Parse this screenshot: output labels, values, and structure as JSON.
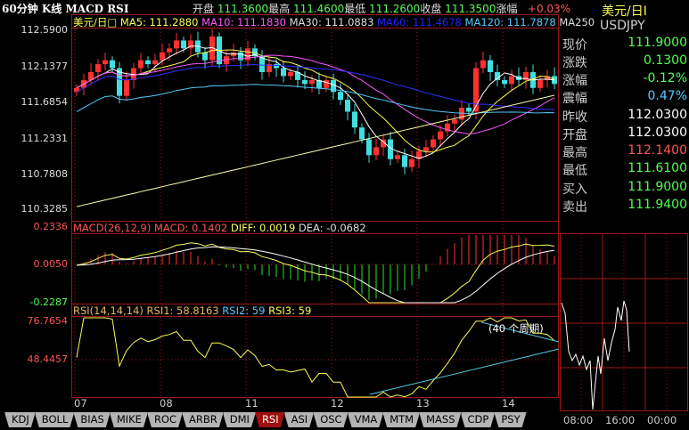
{
  "header": {
    "title": "60分钟 K线 MACD RSI",
    "open_label": "开盘",
    "open": "111.3600",
    "high_label": "最高",
    "high": "111.4600",
    "low_label": "最低",
    "low": "111.2600",
    "close_label": "收盘",
    "close": "111.3500",
    "change_label": "涨幅",
    "change": "+0.03%"
  },
  "ma_legend": {
    "name": "美元/日□",
    "ma5": "MA5: 111.2880",
    "ma10": "MA10: 111.1830",
    "ma30": "MA30: 111.0883",
    "ma60": "MA60: 111.4678",
    "ma120": "MA120: 111.7878",
    "ma250": "MA250"
  },
  "macd_legend": {
    "params": "MACD(26,12,9)",
    "macd": "MACD: 0.1402",
    "diff": "DIFF: 0.0019",
    "dea": "DEA: -0.0682"
  },
  "rsi_legend": {
    "params": "RSI(14,14,14)",
    "rsi1": "RSI1: 58.8163",
    "rsi2": "RSI2: 59",
    "rsi3": "RSI3: 59"
  },
  "side": {
    "name": "美元/日I",
    "code": "USDJPY",
    "rows": [
      {
        "label": "现价",
        "value": "111.9000",
        "color": "#54fc54"
      },
      {
        "label": "涨跌",
        "value": "0.1300",
        "color": "#54fc54"
      },
      {
        "label": "涨幅",
        "value": "-0.12%",
        "color": "#54fc54"
      },
      {
        "label": "震幅",
        "value": "0.47%",
        "color": "#54c8fc"
      },
      {
        "label": "昨收",
        "value": "112.0300",
        "color": "#ffffff"
      },
      {
        "label": "开盘",
        "value": "112.0300",
        "color": "#ffffff"
      },
      {
        "label": "最高",
        "value": "112.1400",
        "color": "#fc5454"
      },
      {
        "label": "最低",
        "value": "111.6100",
        "color": "#54fc54"
      },
      {
        "label": "买入",
        "value": "111.9000",
        "color": "#54fc54"
      },
      {
        "label": "卖出",
        "value": "111.9400",
        "color": "#54fc54"
      }
    ],
    "mini_times": [
      "08:00",
      "16:00",
      "00:00"
    ]
  },
  "tabs": [
    "KDJ",
    "BOLL",
    "BIAS",
    "MIKE",
    "ROC",
    "ARBR",
    "DMI",
    "RSI",
    "ASI",
    "OSC",
    "VMA",
    "MTM",
    "MASS",
    "CDP",
    "PSY"
  ],
  "active_tab": "RSI",
  "chart_data": {
    "type": "candlestick",
    "price_axis": {
      "ticks": [
        "112.5900",
        "112.1377",
        "111.6854",
        "111.2331",
        "110.7808",
        "110.3285"
      ],
      "range": [
        110.3285,
        112.59
      ]
    },
    "macd_axis": {
      "ticks": [
        "0.2336",
        "0.0050",
        "-0.2287"
      ],
      "range": [
        -0.2287,
        0.2336
      ]
    },
    "rsi_axis": {
      "ticks": [
        "76.7654",
        "48.4457"
      ]
    },
    "x_labels": [
      "07",
      "08",
      "11",
      "12",
      "13",
      "14"
    ],
    "x_label_index": [
      0,
      12,
      24,
      36,
      48,
      60
    ],
    "rsi_annotation": "(40 个周期)",
    "closes": [
      111.85,
      111.95,
      112.05,
      112.15,
      112.2,
      112.1,
      111.75,
      111.95,
      112.1,
      112.2,
      112.15,
      112.2,
      112.3,
      112.35,
      112.45,
      112.35,
      112.45,
      112.3,
      112.2,
      112.5,
      112.15,
      112.25,
      112.3,
      112.2,
      112.35,
      112.25,
      112.05,
      112.15,
      112.1,
      112.0,
      112.05,
      111.95,
      111.9,
      111.95,
      111.85,
      111.95,
      111.8,
      111.7,
      111.55,
      111.35,
      111.2,
      111.0,
      111.1,
      111.2,
      110.95,
      111.0,
      110.85,
      110.95,
      111.05,
      111.1,
      111.2,
      111.3,
      111.4,
      111.45,
      111.6,
      111.55,
      112.1,
      112.2,
      112.05,
      111.95,
      111.9,
      112.0,
      111.95,
      112.05,
      111.85,
      111.95,
      112.0,
      111.9
    ],
    "first_open": 111.8
  }
}
